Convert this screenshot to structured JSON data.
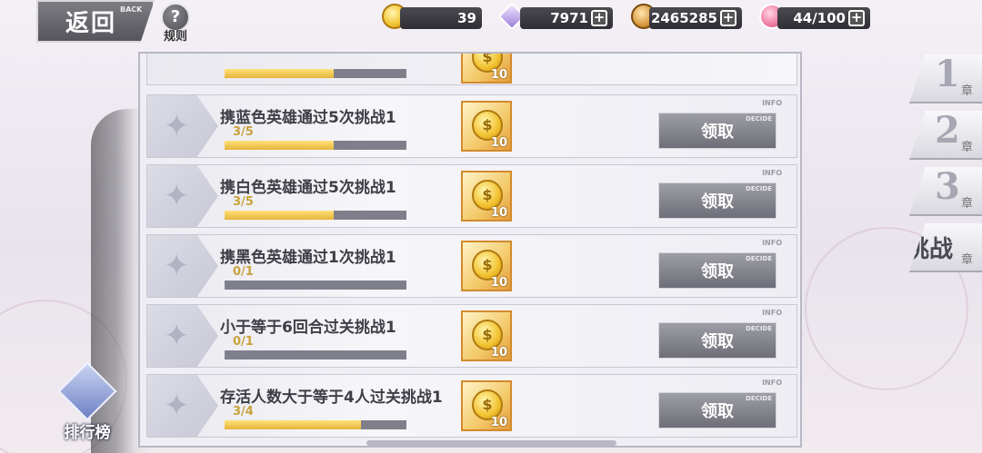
{
  "header": {
    "back_label": "返回",
    "back_tag": "BACK",
    "rules_label": "规则",
    "rules_icon": "?"
  },
  "resources": [
    {
      "icon": "gold-coin-icon",
      "value": "39",
      "has_plus": false
    },
    {
      "icon": "crystal-icon",
      "value": "7971",
      "has_plus": true
    },
    {
      "icon": "bronze-coin-icon",
      "value": "2465285",
      "has_plus": true
    },
    {
      "icon": "heart-stamina-icon",
      "value": "44/100",
      "has_plus": true
    }
  ],
  "chapters": [
    {
      "label": "1",
      "suffix": "章"
    },
    {
      "label": "2",
      "suffix": "章"
    },
    {
      "label": "3",
      "suffix": "章"
    },
    {
      "label": "挑战",
      "suffix": "章",
      "active": true
    }
  ],
  "tasks": [
    {
      "title": "携蓝色英雄通过5次挑战1",
      "progress": "3/5",
      "fill": 0.6,
      "reward_qty": "10",
      "button": "领取",
      "info": "INFO",
      "decide": "DECIDE"
    },
    {
      "title": "携白色英雄通过5次挑战1",
      "progress": "3/5",
      "fill": 0.6,
      "reward_qty": "10",
      "button": "领取",
      "info": "INFO",
      "decide": "DECIDE"
    },
    {
      "title": "携黑色英雄通过1次挑战1",
      "progress": "0/1",
      "fill": 0.0,
      "reward_qty": "10",
      "button": "领取",
      "info": "INFO",
      "decide": "DECIDE"
    },
    {
      "title": "小于等于6回合过关挑战1",
      "progress": "0/1",
      "fill": 0.0,
      "reward_qty": "10",
      "button": "领取",
      "info": "INFO",
      "decide": "DECIDE"
    },
    {
      "title": "存活人数大于等于4人过关挑战1",
      "progress": "3/4",
      "fill": 0.75,
      "reward_qty": "10",
      "button": "领取",
      "info": "INFO",
      "decide": "DECIDE"
    }
  ],
  "partial_task": {
    "reward_qty": "10",
    "fill": 0.6
  },
  "leaderboard": {
    "label": "排行榜"
  },
  "colors": {
    "accent_gold": "#e6b43a",
    "button_gray": "#7d7d86"
  }
}
